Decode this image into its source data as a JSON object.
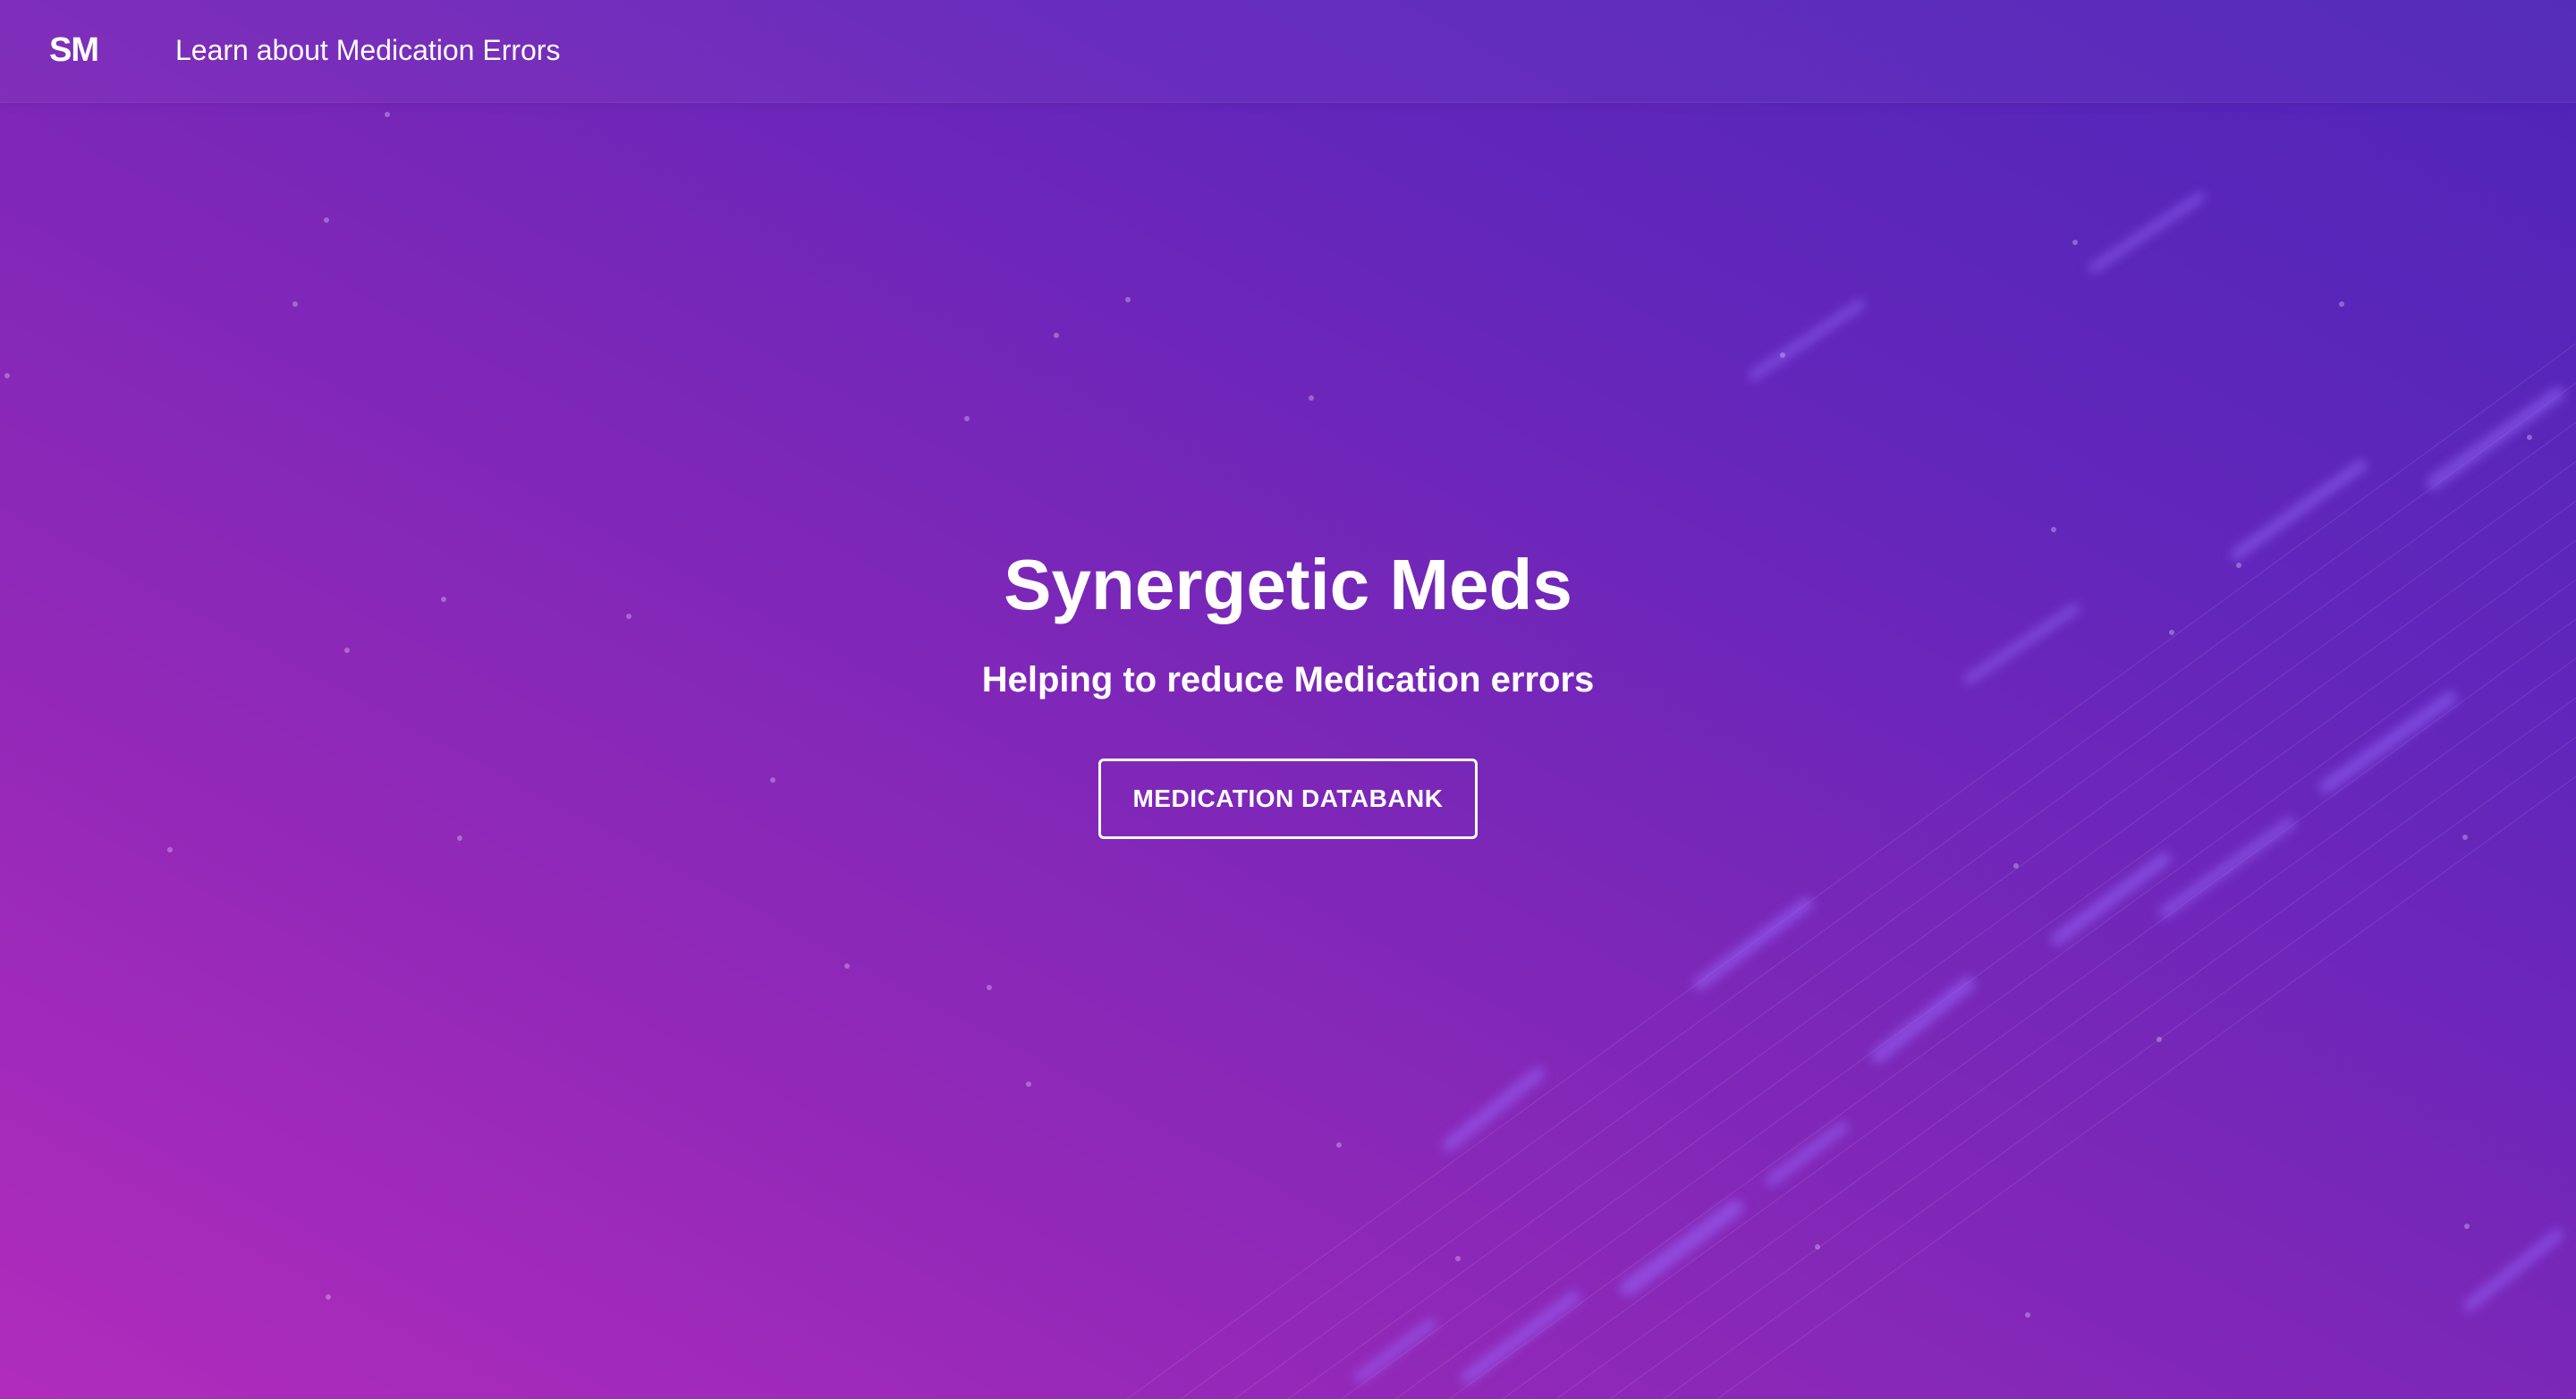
{
  "navbar": {
    "brand": "SM",
    "links": [
      {
        "label": "Learn about Medication Errors"
      }
    ]
  },
  "hero": {
    "title": "Synergetic Meds",
    "subtitle": "Helping to reduce Medication errors",
    "button_label": "MEDICATION DATABANK"
  },
  "colors": {
    "gradient_bottom_left": "#b02cbc",
    "gradient_top_right": "#4f25b8",
    "text": "#ffffff",
    "button_border": "#ffffff"
  }
}
